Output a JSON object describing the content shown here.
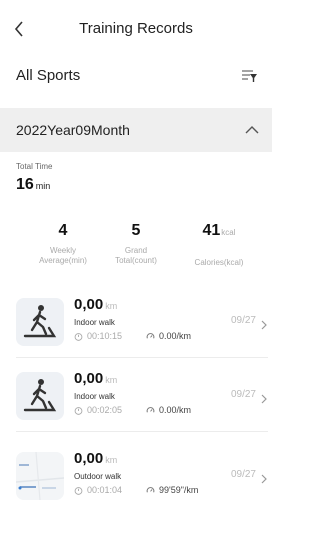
{
  "header": {
    "title": "Training Records"
  },
  "filter": {
    "sport_label": "All Sports"
  },
  "month": {
    "label": "2022Year09Month"
  },
  "summary": {
    "total_time_label": "Total Time",
    "total_time_value": "16",
    "total_time_unit": "min",
    "stats": [
      {
        "value": "4",
        "unit": "",
        "label_line1": "Weekly",
        "label_line2": "Average(min)"
      },
      {
        "value": "5",
        "unit": "",
        "label_line1": "Grand",
        "label_line2": "Total(count)"
      },
      {
        "value": "41",
        "unit": "kcal",
        "label_line1": "",
        "label_line2": "Calories(kcal)"
      }
    ]
  },
  "records": [
    {
      "distance": "0,00",
      "unit": "km",
      "type": "Indoor walk",
      "duration": "00:10:15",
      "pace": "0.00/km",
      "date": "09/27",
      "thumb": "treadmill-walker-icon"
    },
    {
      "distance": "0,00",
      "unit": "km",
      "type": "Indoor walk",
      "duration": "00:02:05",
      "pace": "0.00/km",
      "date": "09/27",
      "thumb": "treadmill-walker-icon"
    },
    {
      "distance": "0,00",
      "unit": "km",
      "type": "Outdoor walk",
      "duration": "00:01:04",
      "pace": "99'59\"/km",
      "date": "09/27",
      "thumb": "map-thumbnail"
    }
  ],
  "colors": {
    "month_bar": "#efefef",
    "thumb_bg": "#eef1f5",
    "muted": "#aaaaaa"
  }
}
